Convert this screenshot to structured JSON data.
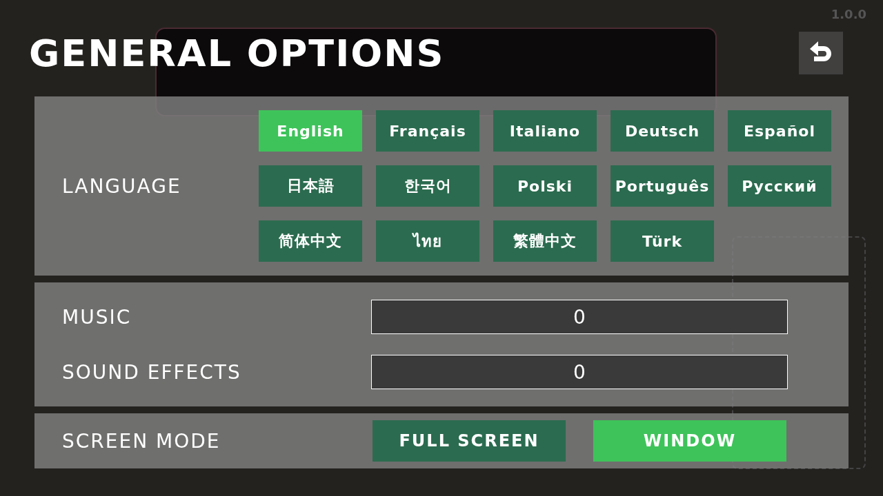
{
  "version": "1.0.0",
  "title": "GENERAL OPTIONS",
  "language": {
    "label": "LANGUAGE",
    "options": [
      {
        "label": "English",
        "selected": true
      },
      {
        "label": "Français",
        "selected": false
      },
      {
        "label": "Italiano",
        "selected": false
      },
      {
        "label": "Deutsch",
        "selected": false
      },
      {
        "label": "Español",
        "selected": false
      },
      {
        "label": "日本語",
        "selected": false
      },
      {
        "label": "한국어",
        "selected": false
      },
      {
        "label": "Polski",
        "selected": false
      },
      {
        "label": "Português",
        "selected": false
      },
      {
        "label": "Русский",
        "selected": false
      },
      {
        "label": "简体中文",
        "selected": false
      },
      {
        "label": "ไทย",
        "selected": false
      },
      {
        "label": "繁體中文",
        "selected": false
      },
      {
        "label": "Türk",
        "selected": false
      }
    ]
  },
  "volumes": [
    {
      "label": "MUSIC",
      "value": "0"
    },
    {
      "label": "SOUND EFFECTS",
      "value": "0"
    }
  ],
  "screen_mode": {
    "label": "SCREEN MODE",
    "options": [
      {
        "label": "FULL SCREEN",
        "selected": false
      },
      {
        "label": "WINDOW",
        "selected": true
      }
    ]
  }
}
